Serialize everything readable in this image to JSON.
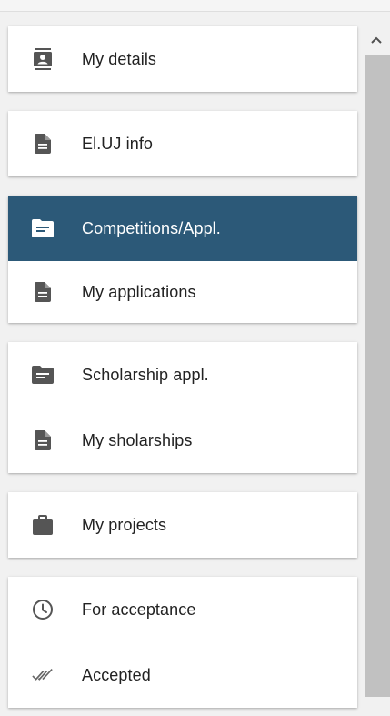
{
  "menu": {
    "my_details": "My details",
    "eluj_info": "El.UJ info",
    "competitions": "Competitions/Appl.",
    "my_applications": "My applications",
    "scholarship_appl": "Scholarship appl.",
    "my_scholarships": "My sholarships",
    "my_projects": "My projects",
    "for_acceptance": "For acceptance",
    "accepted": "Accepted"
  },
  "icons": {
    "my_details": "contact-card-icon",
    "eluj_info": "document-icon",
    "competitions": "folder-icon",
    "my_applications": "document-icon",
    "scholarship_appl": "folder-icon",
    "my_scholarships": "document-icon",
    "my_projects": "briefcase-icon",
    "for_acceptance": "clock-icon",
    "accepted": "double-check-icon",
    "scroll_up": "chevron-up-icon"
  },
  "colors": {
    "active_background": "#2c5978",
    "icon_gray": "#555555",
    "icon_active": "#ffffff"
  },
  "active_item": "Competitions/Appl."
}
